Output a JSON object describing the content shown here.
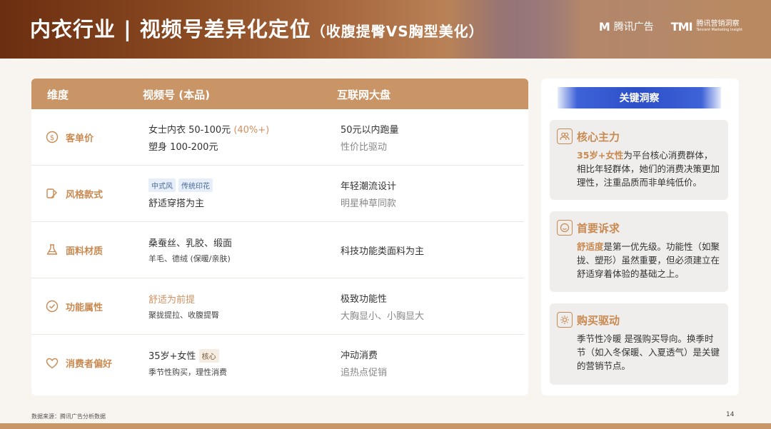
{
  "header": {
    "title": "内衣行业 | 视频号差异化定位",
    "subtitle": "（收腹提臀VS胸型美化）",
    "logo1_mark": "M",
    "logo1_text": "腾讯广告",
    "logo2_mark": "TMI",
    "logo2_text": "腾讯营销洞察",
    "logo2_small": "Tencent Marketing Insight"
  },
  "table": {
    "headers": [
      "维度",
      "视频号 (本品)",
      "互联网大盘"
    ],
    "rows": [
      {
        "dimension": "客单价",
        "icon": "dollar-icon",
        "col2_line1_a": "女士内衣 50-100元 ",
        "col2_line1_b": "(40%+)",
        "col2_line2": "塑身 100-200元",
        "col3_line1": "50元以内跑量",
        "col3_line2": "性价比驱动"
      },
      {
        "dimension": "风格款式",
        "icon": "style-icon",
        "col2_tags": [
          "中式风",
          "传统印花"
        ],
        "col2_line2": "舒适穿搭为主",
        "col3_line1": "年轻潮流设计",
        "col3_line2": "明星种草同款"
      },
      {
        "dimension": "面料材质",
        "icon": "flask-icon",
        "col2_line1": "桑蚕丝、乳胶、缎面",
        "col2_line2": "羊毛、德绒 (保暖/亲肤)",
        "col3_line1": "科技功能类面料为主"
      },
      {
        "dimension": "功能属性",
        "icon": "check-circle-icon",
        "col2_line1": "舒适为前提",
        "col2_line2": "聚拢提拉、收腹提臀",
        "col3_line1": "极致功能性",
        "col3_line2": "大胸显小、小胸显大"
      },
      {
        "dimension": "消费者偏好",
        "icon": "heart-icon",
        "col2_line1": "35岁+女性",
        "col2_tag": "核心",
        "col2_line2": "季节性购买，理性消费",
        "col3_line1": "冲动消费",
        "col3_line2": "追热点促销"
      }
    ]
  },
  "insights": {
    "title": "关键洞察",
    "boxes": [
      {
        "title": "核心主力",
        "icon": "users-icon",
        "highlight": "35岁+女性",
        "text": "为平台核心消费群体，相比年轻群体，她们的消费决策更加理性，注重品质而非单纯低价。"
      },
      {
        "title": "首要诉求",
        "icon": "smile-icon",
        "highlight": "舒适度",
        "text": "是第一优先级。功能性（如聚拢、塑形）虽然重要，但必须建立在舒适穿着体验的基础之上。"
      },
      {
        "title": "购买驱动",
        "icon": "sun-icon",
        "highlight": "",
        "text": "季节性冷暖 是强购买导向。换季时节（如入冬保暖、入夏透气）是关键的营销节点。"
      }
    ]
  },
  "footer": {
    "source": "数据来源：腾讯广告分析数据",
    "page": "14"
  },
  "colors": {
    "accent": "#c98a52",
    "header_bar": "#c99466",
    "insight_blue": "#2d4fc8"
  }
}
